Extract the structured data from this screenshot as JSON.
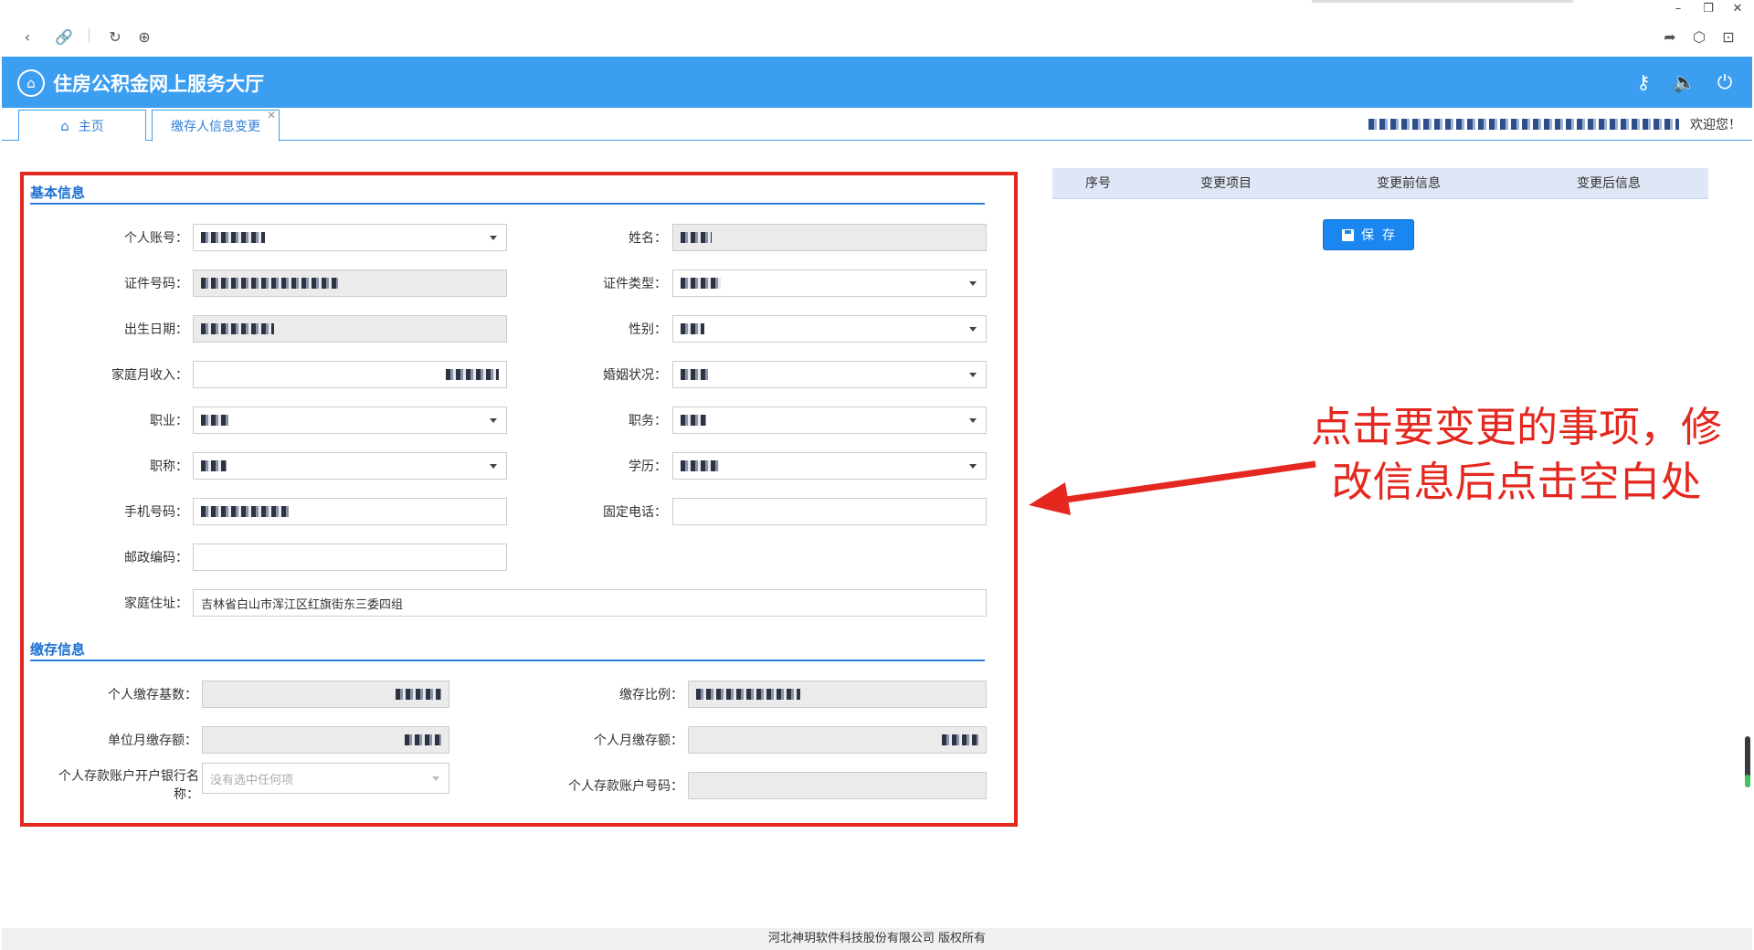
{
  "browser": {
    "icons": [
      "back-icon",
      "link-icon",
      "refresh-icon",
      "globe-icon",
      "share-icon",
      "cube-icon",
      "lock-icon"
    ],
    "window_controls": [
      "minimize",
      "restore",
      "close"
    ]
  },
  "header": {
    "title": "住房公积金网上服务大厅",
    "icons": [
      "key-icon",
      "speaker-icon",
      "power-icon"
    ],
    "color": "#3c9ef0"
  },
  "tabs": {
    "home_label": "主页",
    "active_label": "缴存人信息变更"
  },
  "welcome": {
    "text": "欢迎您！"
  },
  "basic_info": {
    "section_title": "基本信息",
    "fields": {
      "account_label": "个人账号：",
      "name_label": "姓名：",
      "id_number_label": "证件号码：",
      "id_type_label": "证件类型：",
      "birth_label": "出生日期：",
      "gender_label": "性别：",
      "family_income_label": "家庭月收入：",
      "marital_label": "婚姻状况：",
      "occupation_label": "职业：",
      "position_label": "职务：",
      "title_label": "职称：",
      "education_label": "学历：",
      "mobile_label": "手机号码：",
      "phone_label": "固定电话：",
      "postcode_label": "邮政编码：",
      "address_label": "家庭住址：",
      "address_value": "吉林省白山市浑江区红旗街东三委四组"
    }
  },
  "deposit_info": {
    "section_title": "缴存信息",
    "fields": {
      "base_label": "个人缴存基数：",
      "ratio_label": "缴存比例：",
      "unit_monthly_label": "单位月缴存额：",
      "personal_monthly_label": "个人月缴存额：",
      "bank_label": "个人存款账户开户银行名称：",
      "bank_placeholder": "没有选中任何项",
      "bank_account_label": "个人存款账户号码："
    }
  },
  "change_table": {
    "headers": [
      "序号",
      "变更项目",
      "变更前信息",
      "变更后信息"
    ]
  },
  "save_button": {
    "label": "保  存"
  },
  "annotation": {
    "text_line1": "点击要变更的事项，修",
    "text_line2": "改信息后点击空白处",
    "color": "#e4281f"
  },
  "footer": {
    "text": "河北神玥软件科技股份有限公司 版权所有"
  }
}
